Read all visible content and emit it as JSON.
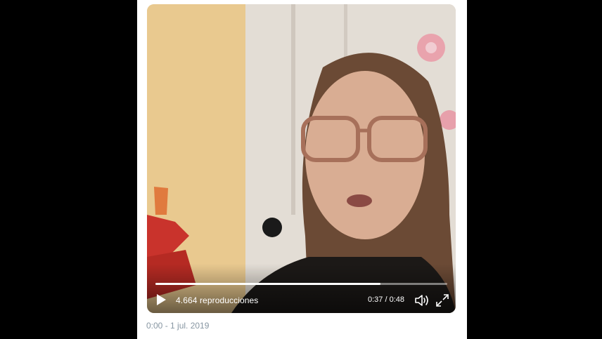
{
  "video": {
    "views": "4.664 reproducciones",
    "time": "0:37 / 0:48",
    "progress": 0.77,
    "play_icon": "play-icon",
    "volume_icon": "volume-icon",
    "fullscreen_icon": "fullscreen-icon"
  },
  "tweet": {
    "timestamp": "0:00 - 1 jul. 2019"
  },
  "colors": {
    "page_background": "#000000",
    "card_background": "#ffffff",
    "meta_text": "#8796a2"
  }
}
